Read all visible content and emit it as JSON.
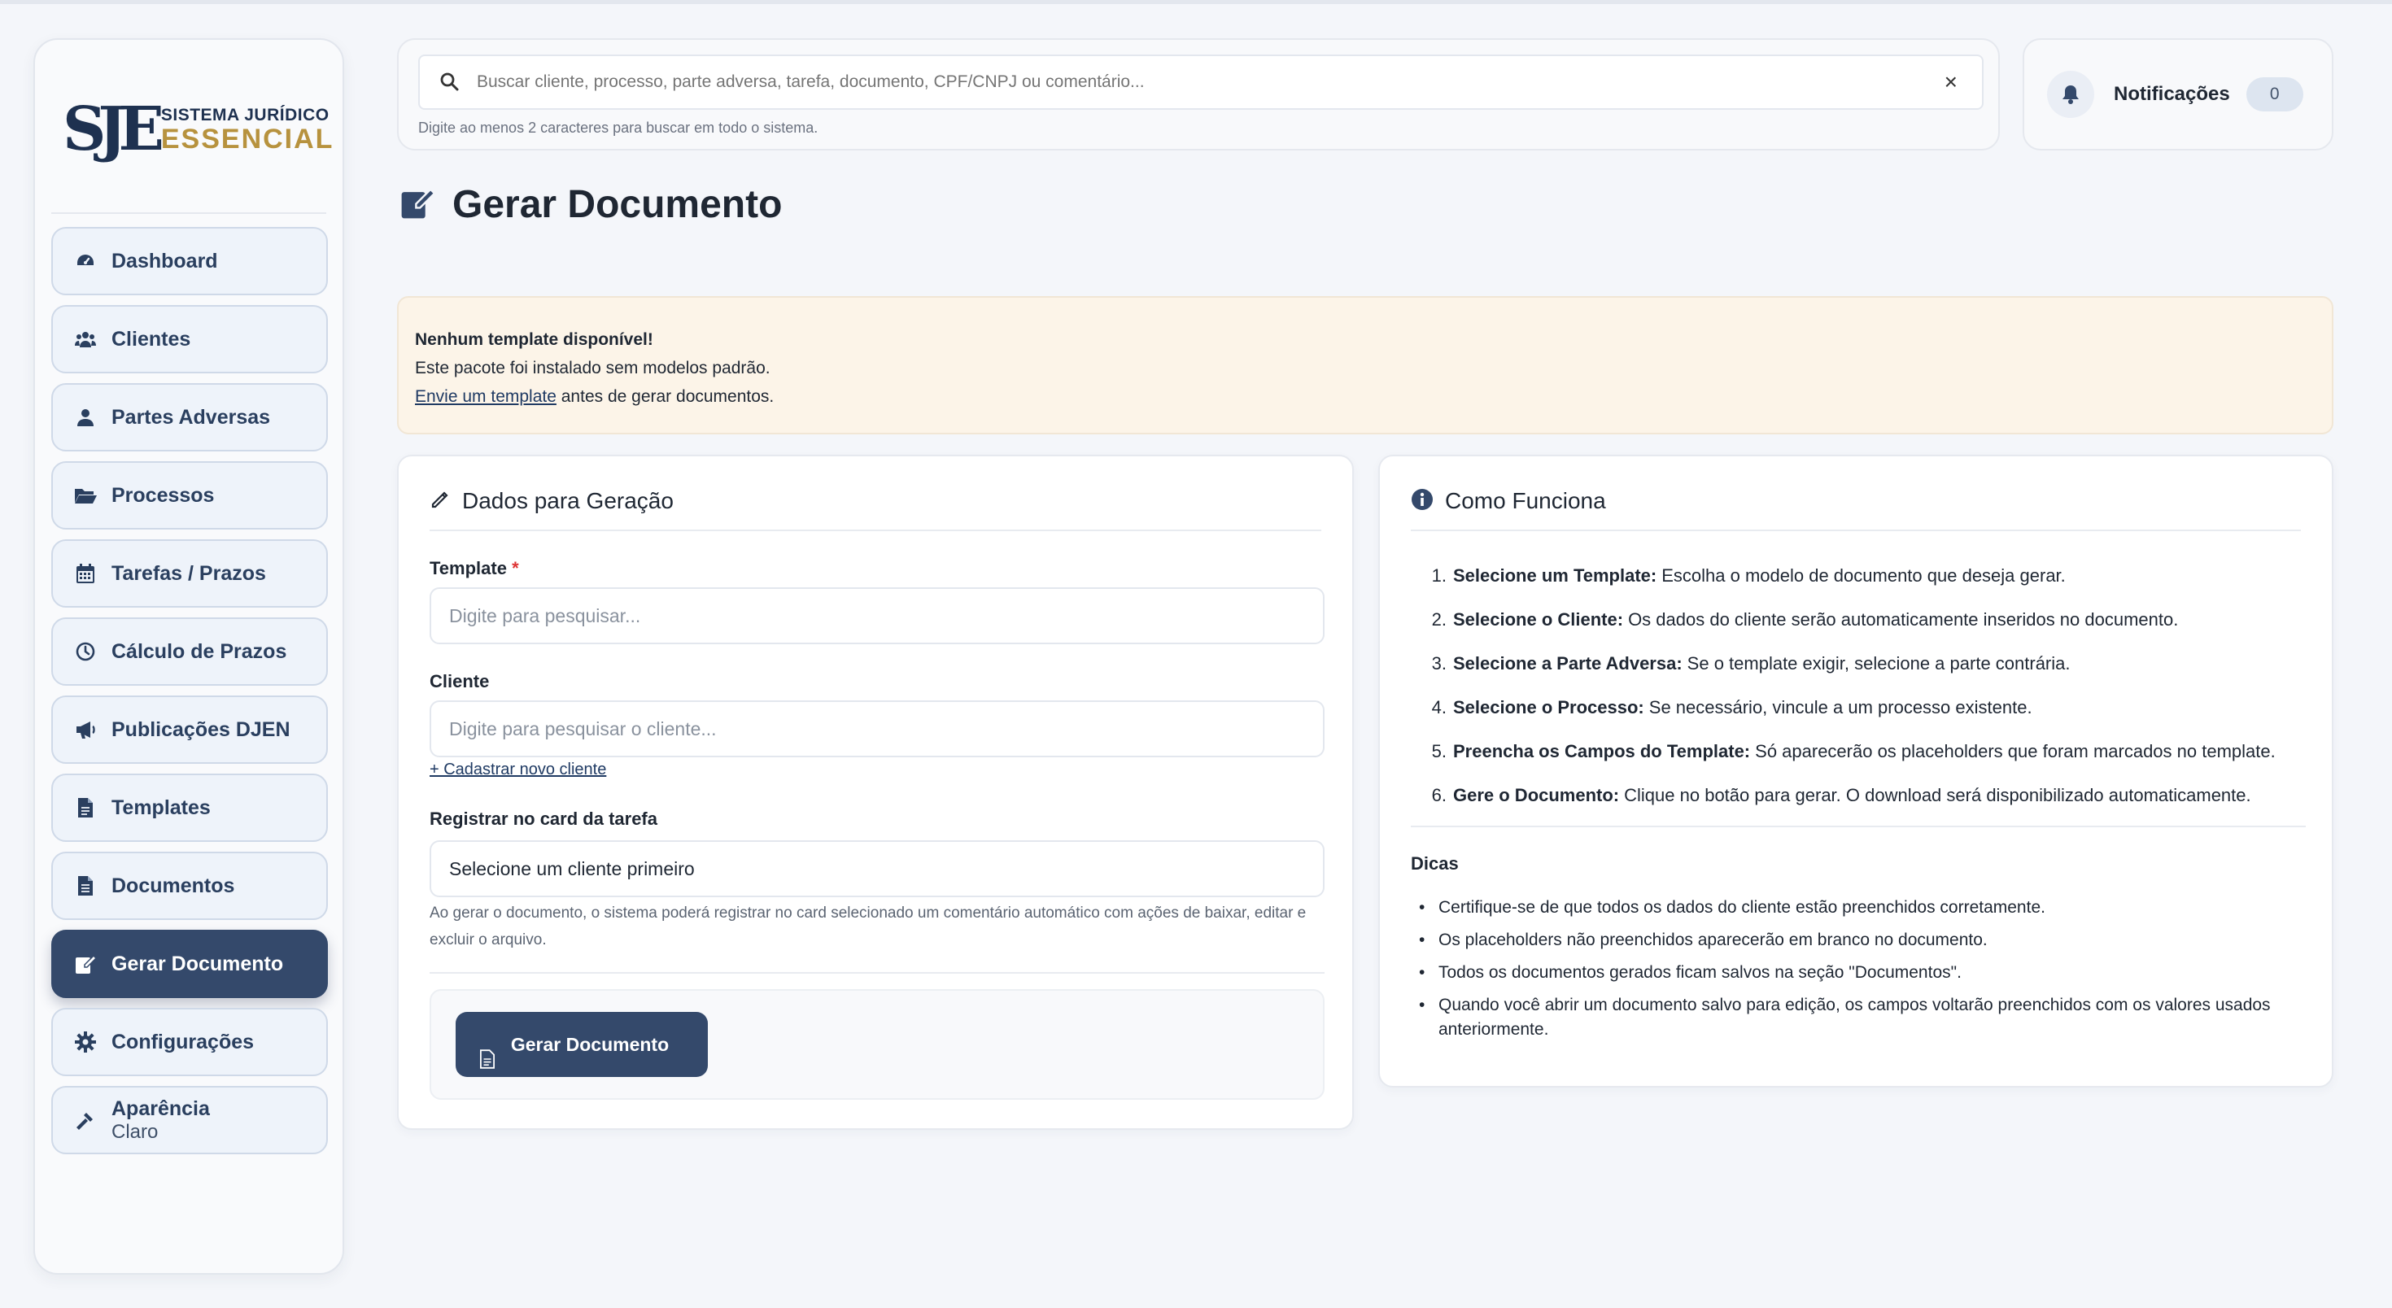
{
  "app": {
    "logo_mark": "SJE",
    "logo_line1": "SISTEMA JURÍDICO",
    "logo_line2": "ESSENCIAL"
  },
  "sidebar": {
    "items": [
      {
        "label": "Dashboard",
        "icon": "gauge-icon",
        "active": false
      },
      {
        "label": "Clientes",
        "icon": "users-icon",
        "active": false
      },
      {
        "label": "Partes Adversas",
        "icon": "user-icon",
        "active": false
      },
      {
        "label": "Processos",
        "icon": "folder-open-icon",
        "active": false
      },
      {
        "label": "Tarefas / Prazos",
        "icon": "calendar-icon",
        "active": false
      },
      {
        "label": "Cálculo de Prazos",
        "icon": "clock-icon",
        "active": false
      },
      {
        "label": "Publicações DJEN",
        "icon": "megaphone-icon",
        "active": false
      },
      {
        "label": "Templates",
        "icon": "file-icon",
        "active": false
      },
      {
        "label": "Documentos",
        "icon": "file-lines-icon",
        "active": false
      },
      {
        "label": "Gerar Documento",
        "icon": "edit-document-icon",
        "active": true
      },
      {
        "label": "Configurações",
        "icon": "gear-icon",
        "active": false
      }
    ],
    "appearance": {
      "label": "Aparência",
      "value": "Claro",
      "icon": "hammer-icon"
    }
  },
  "search": {
    "placeholder": "Buscar cliente, processo, parte adversa, tarefa, documento, CPF/CNPJ ou comentário...",
    "hint": "Digite ao menos 2 caracteres para buscar em todo o sistema.",
    "clear": "×"
  },
  "notifications": {
    "label": "Notificações",
    "count": "0"
  },
  "page": {
    "title": "Gerar Documento"
  },
  "alert": {
    "title": "Nenhum template disponível!",
    "line2": "Este pacote foi instalado sem modelos padrão.",
    "link": "Envie um template",
    "line3_rest": " antes de gerar documentos."
  },
  "form": {
    "heading": "Dados para Geração",
    "template_label": "Template",
    "required_mark": "*",
    "template_placeholder": "Digite para pesquisar...",
    "client_label": "Cliente",
    "client_placeholder": "Digite para pesquisar o cliente...",
    "new_client_link": "+ Cadastrar novo cliente",
    "task_label": "Registrar no card da tarefa",
    "task_value": "Selecione um cliente primeiro",
    "task_help": "Ao gerar o documento, o sistema poderá registrar no card selecionado um comentário automático com ações de baixar, editar e excluir o arquivo.",
    "submit": "Gerar Documento"
  },
  "info": {
    "heading": "Como Funciona",
    "steps": [
      {
        "num": "1.",
        "bold": "Selecione um Template:",
        "text": "Escolha o modelo de documento que deseja gerar."
      },
      {
        "num": "2.",
        "bold": "Selecione o Cliente:",
        "text": "Os dados do cliente serão automaticamente inseridos no documento."
      },
      {
        "num": "3.",
        "bold": "Selecione a Parte Adversa:",
        "text": "Se o template exigir, selecione a parte contrária."
      },
      {
        "num": "4.",
        "bold": "Selecione o Processo:",
        "text": "Se necessário, vincule a um processo existente."
      },
      {
        "num": "5.",
        "bold": "Preencha os Campos do Template:",
        "text": "Só aparecerão os placeholders que foram marcados no template."
      },
      {
        "num": "6.",
        "bold": "Gere o Documento:",
        "text": "Clique no botão para gerar. O download será disponibilizado automaticamente."
      }
    ],
    "tips_title": "Dicas",
    "tips": [
      "Certifique-se de que todos os dados do cliente estão preenchidos corretamente.",
      "Os placeholders não preenchidos aparecerão em branco no documento.",
      "Todos os documentos gerados ficam salvos na seção \"Documentos\".",
      "Quando você abrir um documento salvo para edição, os campos voltarão preenchidos com os valores usados anteriormente."
    ]
  },
  "colors": {
    "primary": "#34496b",
    "accent_gold": "#b7923e",
    "alert_bg": "#fcf4e8"
  }
}
